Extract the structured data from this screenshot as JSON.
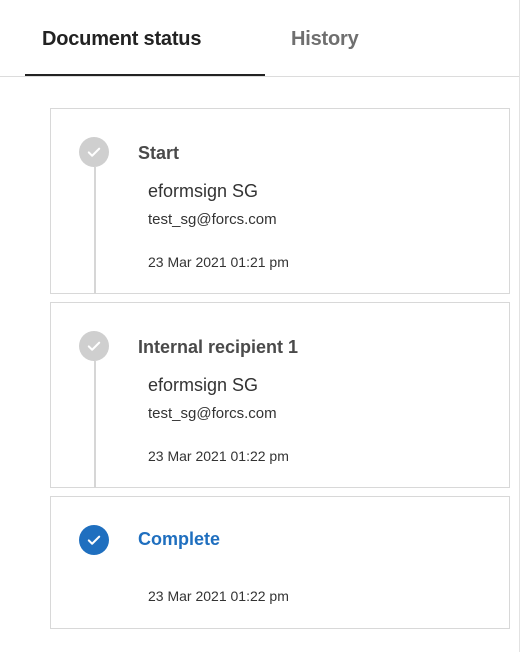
{
  "tabs": {
    "active_label": "Document status",
    "history_label": "History"
  },
  "steps": [
    {
      "title": "Start",
      "name": "eformsign SG",
      "email": "test_sg@forcs.com",
      "timestamp": "23 Mar 2021 01:21 pm",
      "icon": "check-circle-icon"
    },
    {
      "title": "Internal recipient 1",
      "name": "eformsign SG",
      "email": "test_sg@forcs.com",
      "timestamp": "23 Mar 2021 01:22 pm",
      "icon": "check-circle-icon"
    },
    {
      "title": "Complete",
      "timestamp": "23 Mar 2021 01:22 pm",
      "icon": "check-circle-icon"
    }
  ],
  "colors": {
    "accent": "#1f6fbf",
    "done_icon": "#cfcfcf",
    "border": "#d8d8d8"
  }
}
